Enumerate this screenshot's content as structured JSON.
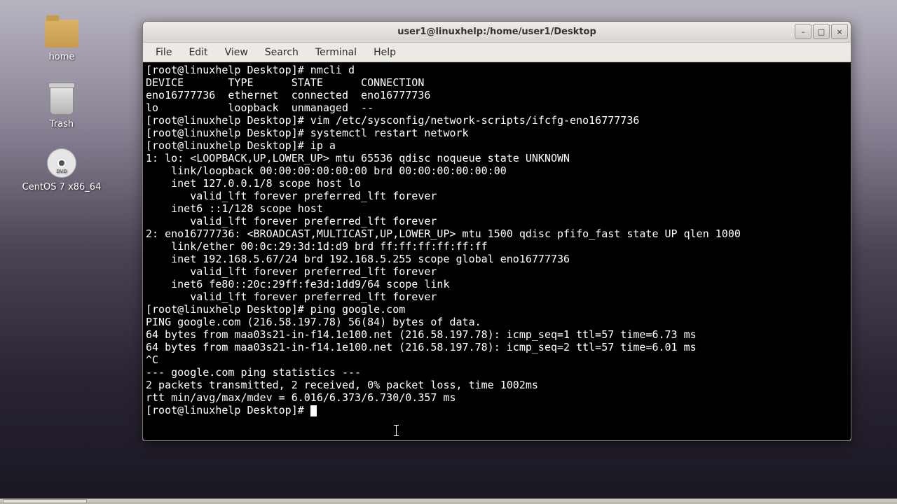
{
  "desktop": {
    "icons": [
      {
        "label": "home"
      },
      {
        "label": "Trash"
      },
      {
        "label": "CentOS 7 x86_64"
      }
    ]
  },
  "window": {
    "title": "user1@linuxhelp:/home/user1/Desktop",
    "buttons": {
      "min": "–",
      "max": "□",
      "close": "×"
    }
  },
  "menubar": [
    "File",
    "Edit",
    "View",
    "Search",
    "Terminal",
    "Help"
  ],
  "terminal": {
    "lines": [
      "[root@linuxhelp Desktop]# nmcli d",
      "DEVICE       TYPE      STATE      CONNECTION",
      "eno16777736  ethernet  connected  eno16777736",
      "lo           loopback  unmanaged  --",
      "[root@linuxhelp Desktop]# vim /etc/sysconfig/network-scripts/ifcfg-eno16777736",
      "[root@linuxhelp Desktop]# systemctl restart network",
      "[root@linuxhelp Desktop]# ip a",
      "1: lo: <LOOPBACK,UP,LOWER_UP> mtu 65536 qdisc noqueue state UNKNOWN",
      "    link/loopback 00:00:00:00:00:00 brd 00:00:00:00:00:00",
      "    inet 127.0.0.1/8 scope host lo",
      "       valid_lft forever preferred_lft forever",
      "    inet6 ::1/128 scope host",
      "       valid_lft forever preferred_lft forever",
      "2: eno16777736: <BROADCAST,MULTICAST,UP,LOWER_UP> mtu 1500 qdisc pfifo_fast state UP qlen 1000",
      "    link/ether 00:0c:29:3d:1d:d9 brd ff:ff:ff:ff:ff:ff",
      "    inet 192.168.5.67/24 brd 192.168.5.255 scope global eno16777736",
      "       valid_lft forever preferred_lft forever",
      "    inet6 fe80::20c:29ff:fe3d:1dd9/64 scope link",
      "       valid_lft forever preferred_lft forever",
      "[root@linuxhelp Desktop]# ping google.com",
      "PING google.com (216.58.197.78) 56(84) bytes of data.",
      "64 bytes from maa03s21-in-f14.1e100.net (216.58.197.78): icmp_seq=1 ttl=57 time=6.73 ms",
      "64 bytes from maa03s21-in-f14.1e100.net (216.58.197.78): icmp_seq=2 ttl=57 time=6.01 ms",
      "^C",
      "--- google.com ping statistics ---",
      "2 packets transmitted, 2 received, 0% packet loss, time 1002ms",
      "rtt min/avg/max/mdev = 6.016/6.373/6.730/0.357 ms"
    ],
    "prompt": "[root@linuxhelp Desktop]# "
  }
}
